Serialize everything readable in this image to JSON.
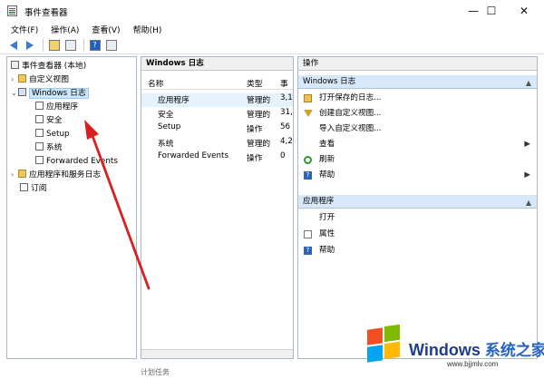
{
  "window": {
    "title": "事件查看器",
    "controls": {
      "minimize": "—",
      "maximize": "☐",
      "close": "✕"
    }
  },
  "menu": [
    "文件(F)",
    "操作(A)",
    "查看(V)",
    "帮助(H)"
  ],
  "left_tree": {
    "root": "事件查看器 (本地)",
    "custom_views": "自定义视图",
    "windows_logs": "Windows 日志",
    "children": [
      "应用程序",
      "安全",
      "Setup",
      "系统",
      "Forwarded Events"
    ],
    "apps_services": "应用程序和服务日志",
    "subscriptions": "订阅"
  },
  "middle": {
    "header": "Windows 日志",
    "columns": [
      "名称",
      "类型",
      "事"
    ],
    "rows": [
      [
        "应用程序",
        "管理的",
        "3,1"
      ],
      [
        "安全",
        "管理的",
        "31,"
      ],
      [
        "Setup",
        "操作",
        "56"
      ],
      [
        "系统",
        "管理的",
        "4,2"
      ],
      [
        "Forwarded Events",
        "操作",
        "0"
      ]
    ]
  },
  "right": {
    "header": "操作",
    "section1": "Windows 日志",
    "section1_items": [
      "打开保存的日志...",
      "创建自定义视图...",
      "导入自定义视图...",
      "查看",
      "刷新",
      "帮助"
    ],
    "section2": "应用程序",
    "section2_items": [
      "打开",
      "属性",
      "帮助"
    ]
  },
  "watermark": {
    "brand": "Windows",
    "brand_cn": "系统之家",
    "url": "www.bjjmlv.com"
  },
  "bottom_partial": "计划任务"
}
